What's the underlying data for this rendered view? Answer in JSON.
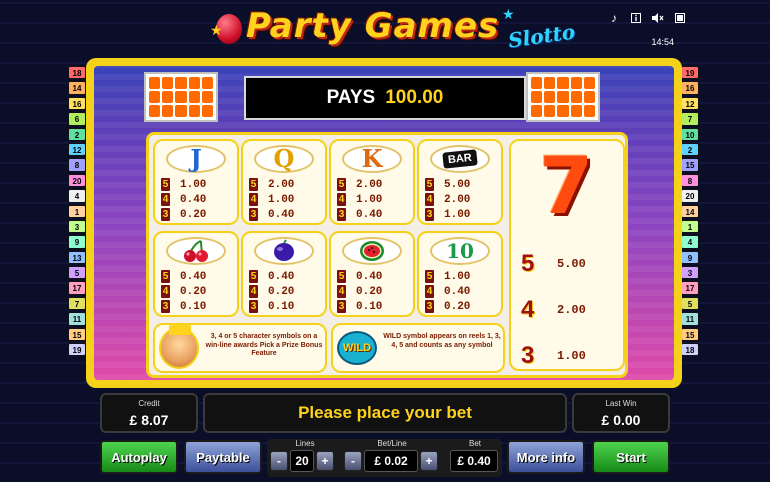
{
  "header": {
    "logo_title": "Party Games",
    "logo_subtitle": "Slotto",
    "time": "14:54",
    "icons": [
      "music-note-icon",
      "info-icon",
      "speaker-mute-icon",
      "fullscreen-icon"
    ]
  },
  "paylines": {
    "left": [
      "18",
      "14",
      "16",
      "6",
      "2",
      "12",
      "8",
      "20",
      "4",
      "1",
      "3",
      "9",
      "13",
      "5",
      "17",
      "7",
      "11",
      "15",
      "19"
    ],
    "right": [
      "19",
      "16",
      "12",
      "7",
      "10",
      "2",
      "15",
      "8",
      "20",
      "14",
      "1",
      "4",
      "9",
      "3",
      "17",
      "5",
      "11",
      "15",
      "18"
    ]
  },
  "pays": {
    "label": "PAYS",
    "value": "100.00"
  },
  "symbols": [
    {
      "name": "J",
      "pays": [
        {
          "n": "5",
          "v": "1.00"
        },
        {
          "n": "4",
          "v": "0.40"
        },
        {
          "n": "3",
          "v": "0.20"
        }
      ]
    },
    {
      "name": "Q",
      "pays": [
        {
          "n": "5",
          "v": "2.00"
        },
        {
          "n": "4",
          "v": "1.00"
        },
        {
          "n": "3",
          "v": "0.40"
        }
      ]
    },
    {
      "name": "K",
      "pays": [
        {
          "n": "5",
          "v": "2.00"
        },
        {
          "n": "4",
          "v": "1.00"
        },
        {
          "n": "3",
          "v": "0.40"
        }
      ]
    },
    {
      "name": "BAR",
      "pays": [
        {
          "n": "5",
          "v": "5.00"
        },
        {
          "n": "4",
          "v": "2.00"
        },
        {
          "n": "3",
          "v": "1.00"
        }
      ]
    },
    {
      "name": "cherry",
      "pays": [
        {
          "n": "5",
          "v": "0.40"
        },
        {
          "n": "4",
          "v": "0.20"
        },
        {
          "n": "3",
          "v": "0.10"
        }
      ]
    },
    {
      "name": "plum",
      "pays": [
        {
          "n": "5",
          "v": "0.40"
        },
        {
          "n": "4",
          "v": "0.20"
        },
        {
          "n": "3",
          "v": "0.10"
        }
      ]
    },
    {
      "name": "watermelon",
      "pays": [
        {
          "n": "5",
          "v": "0.40"
        },
        {
          "n": "4",
          "v": "0.20"
        },
        {
          "n": "3",
          "v": "0.10"
        }
      ]
    },
    {
      "name": "10",
      "pays": [
        {
          "n": "5",
          "v": "1.00"
        },
        {
          "n": "4",
          "v": "0.40"
        },
        {
          "n": "3",
          "v": "0.20"
        }
      ]
    }
  ],
  "seven": {
    "symbol": "7",
    "pays": [
      {
        "n": "5",
        "v": "5.00"
      },
      {
        "n": "4",
        "v": "2.00"
      },
      {
        "n": "3",
        "v": "1.00"
      }
    ]
  },
  "info": {
    "character": "3, 4 or 5 character symbols on a win-line awards Pick a Prize Bonus Feature",
    "wild_badge": "WILD",
    "wild": "WILD symbol appears on reels 1, 3, 4, 5 and counts as any symbol"
  },
  "status": {
    "credit_label": "Credit",
    "credit_value": "£ 8.07",
    "message": "Please place your bet",
    "last_win_label": "Last Win",
    "last_win_value": "£ 0.00"
  },
  "controls": {
    "autoplay": "Autoplay",
    "paytable": "Paytable",
    "lines_label": "Lines",
    "lines_value": "20",
    "betline_label": "Bet/Line",
    "betline_value": "£ 0.02",
    "bet_label": "Bet",
    "bet_value": "£ 0.40",
    "more_info": "More info",
    "start": "Start",
    "minus": "-",
    "plus": "+"
  },
  "colors": {
    "frame_yellow": "#f5d21a",
    "value_brown": "#7a1a00",
    "pays_yellow": "#ffd21e",
    "green_button": "#2bb02b",
    "blue_button": "#5a6cb8"
  }
}
